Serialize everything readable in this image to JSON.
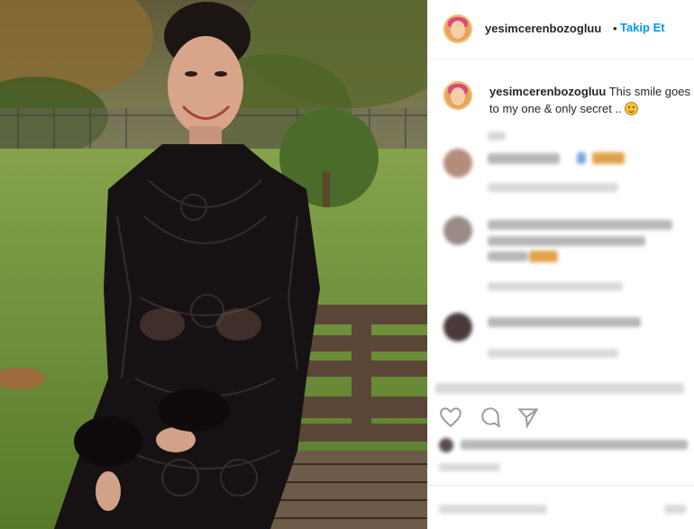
{
  "post": {
    "username": "yesimcerenbozogluu",
    "separator": "•",
    "follow_label": "Takip Et"
  },
  "caption": {
    "username": "yesimcerenbozogluu",
    "text": " This smile goes to my one & only secret .."
  },
  "icons": {
    "like": "heart-icon",
    "comment": "comment-icon",
    "share": "share-icon"
  },
  "colors": {
    "accent": "#0095f6",
    "text": "#262626"
  }
}
